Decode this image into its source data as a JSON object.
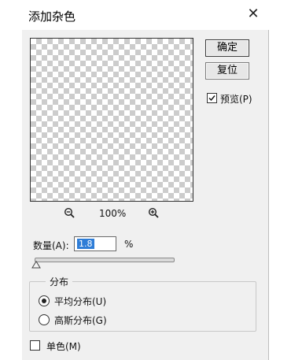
{
  "window": {
    "title": "添加杂色",
    "close_glyph": "✕"
  },
  "buttons": {
    "ok": "确定",
    "reset": "复位"
  },
  "preview_checkbox": {
    "label": "预览(P)",
    "checked": true
  },
  "zoom": {
    "level": "100%",
    "zoom_out_icon": "zoom-out-icon",
    "zoom_in_icon": "zoom-in-icon"
  },
  "amount": {
    "label": "数量(A):",
    "value": "1.8",
    "unit": "%",
    "slider_fraction": 0.018
  },
  "distribution": {
    "legend": "分布",
    "options": [
      {
        "label": "平均分布(U)",
        "selected": true
      },
      {
        "label": "高斯分布(G)",
        "selected": false
      }
    ]
  },
  "monochromatic": {
    "label": "单色(M)",
    "checked": false
  }
}
